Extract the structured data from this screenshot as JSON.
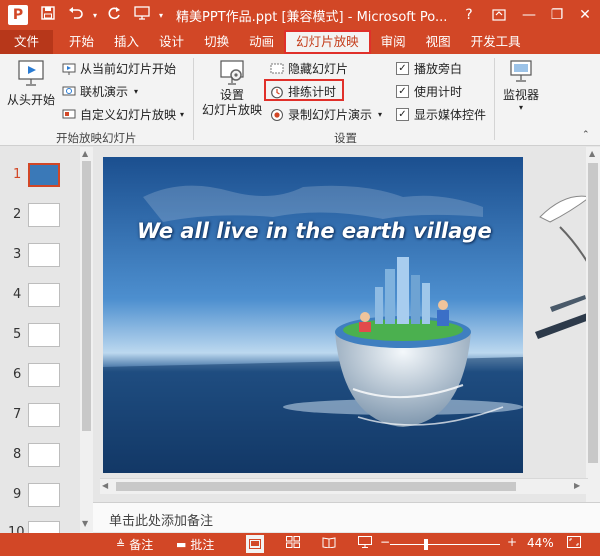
{
  "titlebar": {
    "app_letter": "P",
    "document_title": "精美PPT作品.ppt [兼容模式] - Microsoft Po...",
    "help": "?",
    "minimize": "—",
    "restore": "❐",
    "close": "✕"
  },
  "tabs": [
    {
      "label": "文件"
    },
    {
      "label": "开始"
    },
    {
      "label": "插入"
    },
    {
      "label": "设计"
    },
    {
      "label": "切换"
    },
    {
      "label": "动画"
    },
    {
      "label": "幻灯片放映"
    },
    {
      "label": "审阅"
    },
    {
      "label": "视图"
    },
    {
      "label": "开发工具"
    }
  ],
  "ribbon": {
    "group1": {
      "from_beginning": "从头开始",
      "from_current": "从当前幻灯片开始",
      "online_present": "联机演示",
      "custom_show": "自定义幻灯片放映",
      "label": "开始放映幻灯片"
    },
    "group2": {
      "setup_line1": "设置",
      "setup_line2": "幻灯片放映",
      "hide_slide": "隐藏幻灯片",
      "rehearse": "排练计时",
      "record": "录制幻灯片演示",
      "play_narration": "播放旁白",
      "use_timings": "使用计时",
      "show_media": "显示媒体控件",
      "label": "设置"
    },
    "group3": {
      "monitor": "监视器"
    }
  },
  "slides": [
    {
      "num": "1"
    },
    {
      "num": "2"
    },
    {
      "num": "3"
    },
    {
      "num": "4"
    },
    {
      "num": "5"
    },
    {
      "num": "6"
    },
    {
      "num": "7"
    },
    {
      "num": "8"
    },
    {
      "num": "9"
    },
    {
      "num": "10"
    }
  ],
  "slide": {
    "title": "We all live in the earth village"
  },
  "notes": {
    "placeholder": "单击此处添加备注"
  },
  "statusbar": {
    "notes": "备注",
    "comments": "批注",
    "zoom": "44%"
  },
  "colors": {
    "accent": "#d24726",
    "highlight_box": "#e0302a"
  }
}
